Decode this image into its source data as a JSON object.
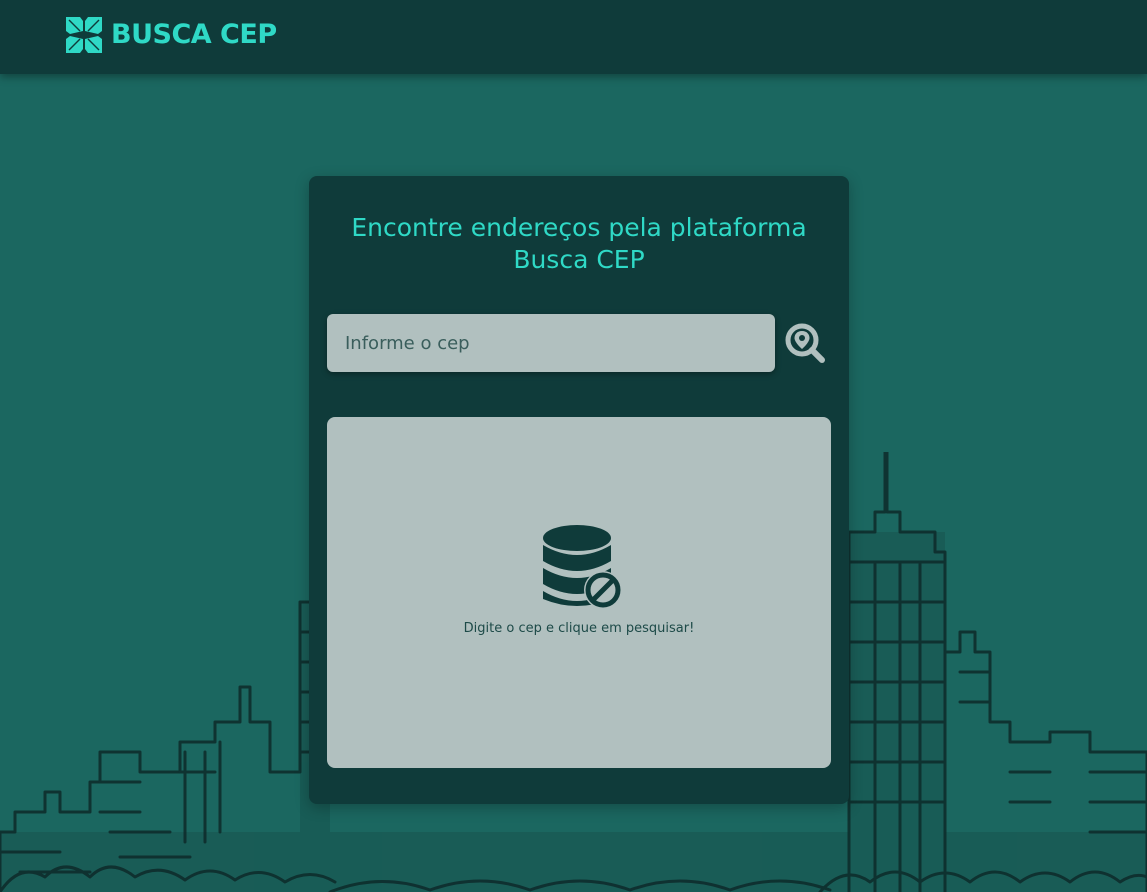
{
  "header": {
    "logo_text": "BUSCA CEP",
    "logo_icon": "cross-grid-icon"
  },
  "search_card": {
    "title": "Encontre endereços pela plataforma Busca CEP",
    "input": {
      "placeholder": "Informe o cep",
      "value": ""
    },
    "search_button_icon": "magnifier-location-icon"
  },
  "result_panel": {
    "empty_icon": "database-blocked-icon",
    "empty_message": "Digite o cep e clique em pesquisar!"
  },
  "colors": {
    "background": "#1b6760",
    "header": "#0f3b3a",
    "card": "#0f3b3a",
    "accent": "#2fd9c6",
    "panel": "#b1c0bf"
  }
}
